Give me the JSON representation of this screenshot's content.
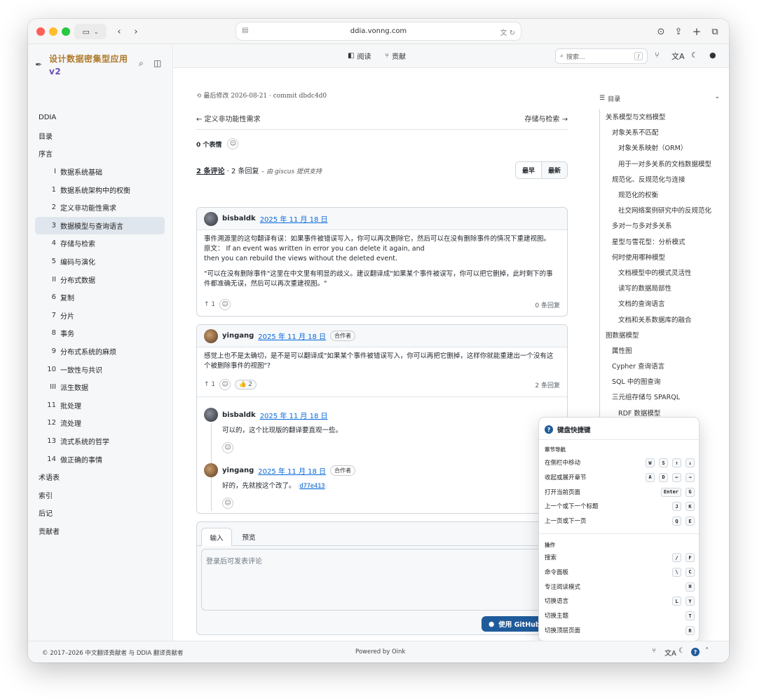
{
  "browser": {
    "url": "ddia.vonng.com",
    "back_icon": "chevron-left",
    "forward_icon": "chevron-right"
  },
  "sidebar": {
    "title": "设计数据密集型应用",
    "version": "v2",
    "items": [
      {
        "label": "DDIA",
        "num": "",
        "sub": false
      },
      {
        "label": "目录",
        "num": "",
        "sub": false
      },
      {
        "label": "序言",
        "num": "",
        "sub": false
      },
      {
        "label": "数据系统基础",
        "num": "I",
        "sub": true
      },
      {
        "label": "数据系统架构中的权衡",
        "num": "1",
        "sub": true
      },
      {
        "label": "定义非功能性需求",
        "num": "2",
        "sub": true
      },
      {
        "label": "数据模型与查询语言",
        "num": "3",
        "sub": true,
        "active": true
      },
      {
        "label": "存储与检索",
        "num": "4",
        "sub": true
      },
      {
        "label": "编码与演化",
        "num": "5",
        "sub": true
      },
      {
        "label": "分布式数据",
        "num": "II",
        "sub": true
      },
      {
        "label": "复制",
        "num": "6",
        "sub": true
      },
      {
        "label": "分片",
        "num": "7",
        "sub": true
      },
      {
        "label": "事务",
        "num": "8",
        "sub": true
      },
      {
        "label": "分布式系统的麻烦",
        "num": "9",
        "sub": true
      },
      {
        "label": "一致性与共识",
        "num": "10",
        "sub": true
      },
      {
        "label": "派生数据",
        "num": "III",
        "sub": true
      },
      {
        "label": "批处理",
        "num": "11",
        "sub": true
      },
      {
        "label": "流处理",
        "num": "12",
        "sub": true
      },
      {
        "label": "流式系统的哲学",
        "num": "13",
        "sub": true
      },
      {
        "label": "做正确的事情",
        "num": "14",
        "sub": true
      },
      {
        "label": "术语表",
        "num": "",
        "sub": false
      },
      {
        "label": "索引",
        "num": "",
        "sub": false
      },
      {
        "label": "后记",
        "num": "",
        "sub": false
      },
      {
        "label": "贡献者",
        "num": "",
        "sub": false
      }
    ]
  },
  "header": {
    "read_label": "阅读",
    "contribute_label": "贡献",
    "search_placeholder": "搜索...",
    "search_key": "/"
  },
  "main": {
    "last_modified": "最后修改 2026-08-21 · commit dbdc4d0",
    "prev_label": "← 定义非功能性需求",
    "next_label": "存储与检索 →",
    "reactions_label": "0 个表情",
    "comments_count": "2 条评论",
    "replies_count": " · 2 条回复",
    "powered_by": "– 由 giscus 提供支持",
    "sort_oldest": "最早",
    "sort_newest": "最新",
    "comments": [
      {
        "user": "bisbaldk",
        "date": "2025 年 11 月 18 日",
        "lines": [
          "事件溯源里的这句翻译有误：如果事件被错误写入，你可以再次删除它，然后可以在没有删除事件的情况下重建视图。",
          "原文： If an event was written in error you can delete it again, and",
          "then you can rebuild the views without the deleted event.",
          "",
          "\"可以在没有删除事件\"这里在中文里有明显的歧义。建议翻译成\"如果某个事件被误写，你可以把它删掉，此时剩下的事",
          "件都准确无误，然后可以再次重建视图。\""
        ],
        "upvotes": "↑ 1",
        "replies": "0 条回复"
      },
      {
        "user": "yingang",
        "date": "2025 年 11 月 18 日",
        "badge": "合作者",
        "lines": [
          "感觉上也不是太确切，是不是可以翻译成\"如果某个事件被错误写入，你可以再把它删掉，这样你就能重建出一个没有这",
          "个被删除事件的视图\"?"
        ],
        "upvotes": "↑ 1",
        "thumbs": "👍 2",
        "replies": "2 条回复"
      }
    ],
    "replies": [
      {
        "user": "bisbaldk",
        "date": "2025 年 11 月 18 日",
        "text": "可以的，这个比现版的翻译要直观一些。"
      },
      {
        "user": "yingang",
        "date": "2025 年 11 月 18 日",
        "badge": "合作者",
        "text": "好的，先就按这个改了。",
        "commit": "d77e413"
      }
    ],
    "editor": {
      "tab_write": "输入",
      "tab_preview": "预览",
      "placeholder": "登录后可发表评论",
      "github_button": "使用 GitHub"
    }
  },
  "toc": {
    "title": "目录",
    "items": [
      {
        "label": "关系模型与文档模型",
        "level": 0
      },
      {
        "label": "对象关系不匹配",
        "level": 1
      },
      {
        "label": "对象关系映射（ORM）",
        "level": 2
      },
      {
        "label": "用于一对多关系的文档数据模型",
        "level": 2
      },
      {
        "label": "规范化、反规范化与连接",
        "level": 1
      },
      {
        "label": "规范化的权衡",
        "level": 2
      },
      {
        "label": "社交网络案例研究中的反规范化",
        "level": 2
      },
      {
        "label": "多对一与多对多关系",
        "level": 1
      },
      {
        "label": "星型与雪花型：分析模式",
        "level": 1
      },
      {
        "label": "何时使用哪种模型",
        "level": 1
      },
      {
        "label": "文档模型中的模式灵活性",
        "level": 2
      },
      {
        "label": "读写的数据局部性",
        "level": 2
      },
      {
        "label": "文档的查询语言",
        "level": 2
      },
      {
        "label": "文档和关系数据库的融合",
        "level": 2
      },
      {
        "label": "图数据模型",
        "level": 0
      },
      {
        "label": "属性图",
        "level": 1
      },
      {
        "label": "Cypher 查询语言",
        "level": 1
      },
      {
        "label": "SQL 中的图查询",
        "level": 1
      },
      {
        "label": "三元组存储与 SPARQL",
        "level": 1
      },
      {
        "label": "RDF 数据模型",
        "level": 2
      }
    ]
  },
  "shortcuts": {
    "title": "键盘快捷键",
    "section_nav": "章节导航",
    "section_actions": "操作",
    "nav": [
      {
        "label": "在侧栏中移动",
        "keys": [
          "W",
          "S",
          "↑",
          "↓"
        ]
      },
      {
        "label": "收起或展开章节",
        "keys": [
          "A",
          "D",
          "←",
          "→"
        ]
      },
      {
        "label": "打开当前页面",
        "keys": [
          "Enter",
          "G"
        ]
      },
      {
        "label": "上一个或下一个标题",
        "keys": [
          "J",
          "K"
        ]
      },
      {
        "label": "上一页或下一页",
        "keys": [
          "Q",
          "E"
        ]
      }
    ],
    "actions": [
      {
        "label": "搜索",
        "keys": [
          "/",
          "F"
        ]
      },
      {
        "label": "命令面板",
        "keys": [
          "\\",
          "C"
        ]
      },
      {
        "label": "专注阅读模式",
        "keys": [
          "H"
        ]
      },
      {
        "label": "切换语言",
        "keys": [
          "L",
          "Y"
        ]
      },
      {
        "label": "切换主题",
        "keys": [
          "T"
        ]
      },
      {
        "label": "切换顶层页面",
        "keys": [
          "R"
        ]
      }
    ]
  },
  "footer": {
    "copyright": "© 2017–2026  中文翻译贡献者 与 DDIA 翻译贡献者",
    "powered": "Powered by Oink"
  },
  "colors": {
    "accent": "#1f5b9b",
    "link": "#0969da",
    "brand": "#b07a2c"
  }
}
